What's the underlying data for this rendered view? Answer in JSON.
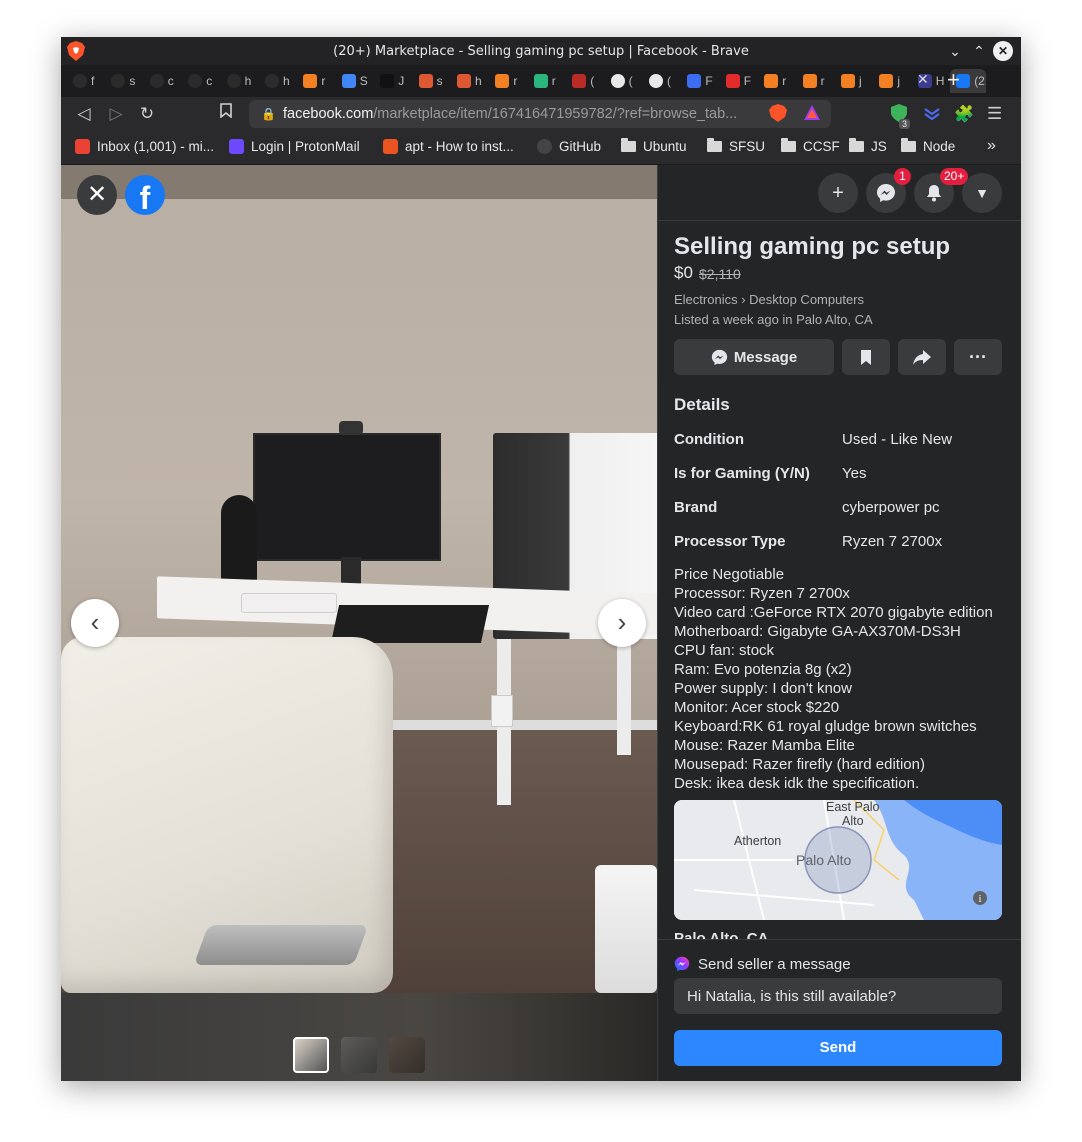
{
  "browser": {
    "window_title": "(20+) Marketplace - Selling gaming pc setup | Facebook - Brave",
    "url_host": "facebook.com",
    "url_path": "/marketplace/item/167416471959782/?ref=browse_tab...",
    "tabs": [
      {
        "label": "f",
        "icon": "github-icon"
      },
      {
        "label": "s",
        "icon": "github-icon"
      },
      {
        "label": "c",
        "icon": "github-icon"
      },
      {
        "label": "c",
        "icon": "github-icon"
      },
      {
        "label": "h",
        "icon": "github-icon"
      },
      {
        "label": "h",
        "icon": "github-icon"
      },
      {
        "label": "r",
        "icon": "stackoverflow-icon"
      },
      {
        "label": "S",
        "icon": "docs-icon"
      },
      {
        "label": "J",
        "icon": "chatgpt-icon"
      },
      {
        "label": "s",
        "icon": "duckduckgo-icon"
      },
      {
        "label": "h",
        "icon": "duckduckgo-icon"
      },
      {
        "label": "r",
        "icon": "stackoverflow-icon"
      },
      {
        "label": "r",
        "icon": "terminal-icon"
      },
      {
        "label": "(",
        "icon": "quora-icon"
      },
      {
        "label": "(",
        "icon": "globe-icon"
      },
      {
        "label": "(",
        "icon": "globe-icon"
      },
      {
        "label": "F",
        "icon": "mdb-icon"
      },
      {
        "label": "F",
        "icon": "vercel-icon"
      },
      {
        "label": "r",
        "icon": "stackoverflow-icon"
      },
      {
        "label": "r",
        "icon": "stackoverflow-icon"
      },
      {
        "label": "j",
        "icon": "stackoverflow-icon"
      },
      {
        "label": "j",
        "icon": "stackoverflow-icon"
      },
      {
        "label": "H",
        "icon": "a-icon"
      },
      {
        "label": "(2",
        "icon": "facebook-icon"
      }
    ],
    "bookmarks": [
      {
        "label": "Inbox (1,001) - mi...",
        "icon": "gmail-icon"
      },
      {
        "label": "Login | ProtonMail",
        "icon": "protonmail-icon"
      },
      {
        "label": "apt - How to inst...",
        "icon": "askubuntu-icon"
      },
      {
        "label": "GitHub",
        "icon": "github-icon"
      },
      {
        "label": "Ubuntu",
        "icon": "folder-icon"
      },
      {
        "label": "SFSU",
        "icon": "folder-icon"
      },
      {
        "label": "CCSF",
        "icon": "folder-icon"
      },
      {
        "label": "JS",
        "icon": "folder-icon"
      },
      {
        "label": "Node",
        "icon": "folder-icon"
      }
    ],
    "shield_count": "3",
    "colors": {
      "titlebar": "#232325",
      "brave_orange": "#fb542b"
    }
  },
  "header": {
    "messenger_badge": "1",
    "notification_badge": "20+"
  },
  "listing": {
    "title": "Selling gaming pc setup",
    "price": "$0",
    "original_price": "$2,110",
    "category": "Electronics › Desktop Computers",
    "listed": "Listed a week ago in Palo Alto, CA",
    "message_button": "Message",
    "details_heading": "Details",
    "details": [
      {
        "key": "Condition",
        "value": "Used - Like New"
      },
      {
        "key": "Is for Gaming (Y/N)",
        "value": "Yes"
      },
      {
        "key": "Brand",
        "value": "cyberpower pc"
      },
      {
        "key": "Processor Type",
        "value": "Ryzen 7 2700x"
      }
    ],
    "description": [
      "Price Negotiable",
      "Processor: Ryzen 7 2700x",
      "Video card :GeForce RTX 2070 gigabyte edition",
      "Motherboard: Gigabyte GA-AX370M-DS3H",
      "CPU fan: stock",
      "Ram: Evo potenzia 8g (x2)",
      "Power supply: I don't know",
      "Monitor: Acer stock $220",
      "Keyboard:RK 61 royal gludge brown switches",
      "Mouse: Razer Mamba Elite",
      "Mousepad: Razer firefly (hard edition)",
      "Desk: ikea desk idk the specification."
    ],
    "map": {
      "labels": [
        "East Palo",
        "Alto",
        "Atherton",
        "Palo Alto"
      ]
    },
    "location": "Palo Alto, CA",
    "send_label": "Send seller a message",
    "message_value": "Hi Natalia, is this still available?",
    "send_button": "Send",
    "accent": "#2d88ff"
  }
}
